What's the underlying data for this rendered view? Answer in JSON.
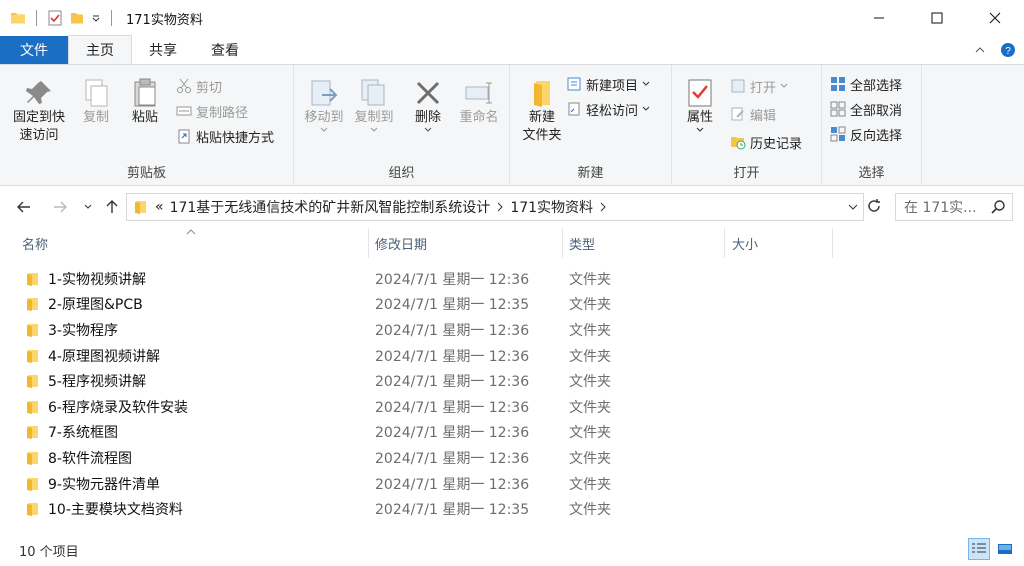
{
  "window": {
    "title": "171实物资料"
  },
  "tabs": {
    "file": "文件",
    "home": "主页",
    "share": "共享",
    "view": "查看"
  },
  "ribbon": {
    "clipboard": {
      "label": "剪贴板",
      "pin_line1": "固定到快",
      "pin_line2": "速访问",
      "copy": "复制",
      "paste": "粘贴",
      "cut": "剪切",
      "copy_path": "复制路径",
      "paste_shortcut": "粘贴快捷方式"
    },
    "organize": {
      "label": "组织",
      "move_to": "移动到",
      "copy_to": "复制到",
      "delete": "删除",
      "rename": "重命名"
    },
    "new": {
      "label": "新建",
      "new_folder_line1": "新建",
      "new_folder_line2": "文件夹",
      "new_item": "新建项目",
      "easy_access": "轻松访问"
    },
    "open": {
      "label": "打开",
      "properties": "属性",
      "open": "打开",
      "edit": "编辑",
      "history": "历史记录"
    },
    "select": {
      "label": "选择",
      "select_all": "全部选择",
      "select_none": "全部取消",
      "invert": "反向选择"
    }
  },
  "address": {
    "overflow": "«",
    "crumb1": "171基于无线通信技术的矿井新风智能控制系统设计",
    "crumb2": "171实物资料",
    "search_placeholder": "在 171实..."
  },
  "columns": {
    "name": "名称",
    "date": "修改日期",
    "type": "类型",
    "size": "大小"
  },
  "files": [
    {
      "name": "1-实物视频讲解",
      "date": "2024/7/1 星期一 12:36",
      "type": "文件夹"
    },
    {
      "name": "2-原理图&PCB",
      "date": "2024/7/1 星期一 12:35",
      "type": "文件夹"
    },
    {
      "name": "3-实物程序",
      "date": "2024/7/1 星期一 12:36",
      "type": "文件夹"
    },
    {
      "name": "4-原理图视频讲解",
      "date": "2024/7/1 星期一 12:36",
      "type": "文件夹"
    },
    {
      "name": "5-程序视频讲解",
      "date": "2024/7/1 星期一 12:36",
      "type": "文件夹"
    },
    {
      "name": "6-程序烧录及软件安装",
      "date": "2024/7/1 星期一 12:36",
      "type": "文件夹"
    },
    {
      "name": "7-系统框图",
      "date": "2024/7/1 星期一 12:36",
      "type": "文件夹"
    },
    {
      "name": "8-软件流程图",
      "date": "2024/7/1 星期一 12:36",
      "type": "文件夹"
    },
    {
      "name": "9-实物元器件清单",
      "date": "2024/7/1 星期一 12:36",
      "type": "文件夹"
    },
    {
      "name": "10-主要模块文档资料",
      "date": "2024/7/1 星期一 12:35",
      "type": "文件夹"
    }
  ],
  "status": {
    "count": "10 个项目"
  },
  "colors": {
    "accent": "#1a6fc4",
    "folder": "#f7c547",
    "header_text": "#4c607a"
  }
}
